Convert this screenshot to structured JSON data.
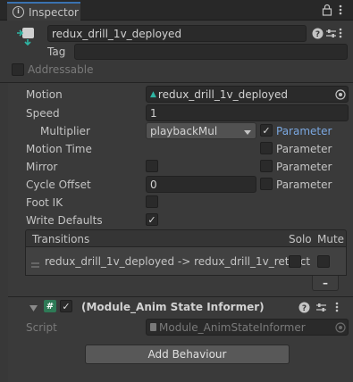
{
  "tab": {
    "title": "Inspector"
  },
  "header": {
    "object_name": "redux_drill_1v_deployed",
    "tag_label": "Tag",
    "tag_value": "",
    "addressable_label": "Addressable"
  },
  "properties": {
    "motion_label": "Motion",
    "motion_value": "redux_drill_1v_deployed",
    "speed_label": "Speed",
    "speed_value": "1",
    "multiplier_label": "Multiplier",
    "multiplier_value": "playbackMul",
    "motion_time_label": "Motion Time",
    "mirror_label": "Mirror",
    "cycle_offset_label": "Cycle Offset",
    "cycle_offset_value": "0",
    "foot_ik_label": "Foot IK",
    "write_defaults_label": "Write Defaults",
    "parameter_label": "Parameter"
  },
  "transitions": {
    "header": "Transitions",
    "solo_label": "Solo",
    "mute_label": "Mute",
    "rows": [
      {
        "name": "redux_drill_1v_deployed -> redux_drill_1v_retract"
      }
    ],
    "remove_label": "–"
  },
  "component": {
    "title": "(Module_Anim State Informer)",
    "script_label": "Script",
    "script_value": "Module_AnimStateInformer"
  },
  "add_behaviour_label": "Add Behaviour"
}
